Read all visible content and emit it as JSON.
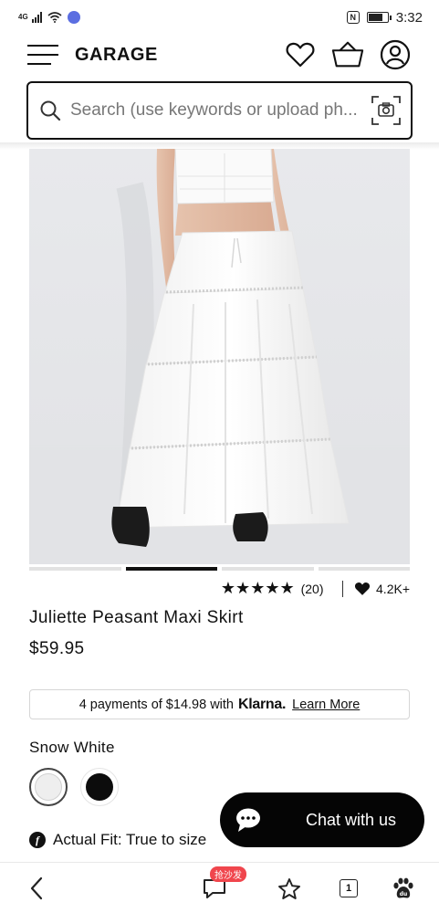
{
  "status_bar": {
    "network": "4G",
    "time": "3:32",
    "battery_level": 0.75
  },
  "header": {
    "logo": "GARAGE",
    "icons": [
      "menu-icon",
      "heart-icon",
      "shopping-bag-icon",
      "account-icon"
    ]
  },
  "search": {
    "placeholder": "Search (use keywords or upload ph..."
  },
  "product": {
    "image_alt": "Juliette Peasant Maxi Skirt",
    "carousel": {
      "total": 4,
      "active_index": 1
    },
    "rating": {
      "stars": 5,
      "review_count": "(20)"
    },
    "likes": "4.2K+",
    "title": "Juliette Peasant Maxi Skirt",
    "price": "$59.95"
  },
  "klarna": {
    "text": "4 payments of $14.98 with",
    "brand": "Klarna.",
    "link_label": "Learn More"
  },
  "color": {
    "selected_label": "Snow White",
    "swatches": [
      {
        "name": "Snow White",
        "hex": "#eeeeee",
        "selected": true
      },
      {
        "name": "Black",
        "hex": "#0c0c0c",
        "selected": false
      }
    ]
  },
  "fit": {
    "label": "Actual Fit: True to size"
  },
  "chat": {
    "label": "Chat with us"
  },
  "bottom_bar": {
    "promo_badge": "抢沙发",
    "tab_count": "1",
    "icons": [
      "back-icon",
      "comment-icon",
      "star-icon",
      "tabs-icon",
      "paw-icon"
    ]
  },
  "colors": {
    "accent": "#111111",
    "chat_bg": "#050505",
    "promo_red": "#f0464d"
  }
}
